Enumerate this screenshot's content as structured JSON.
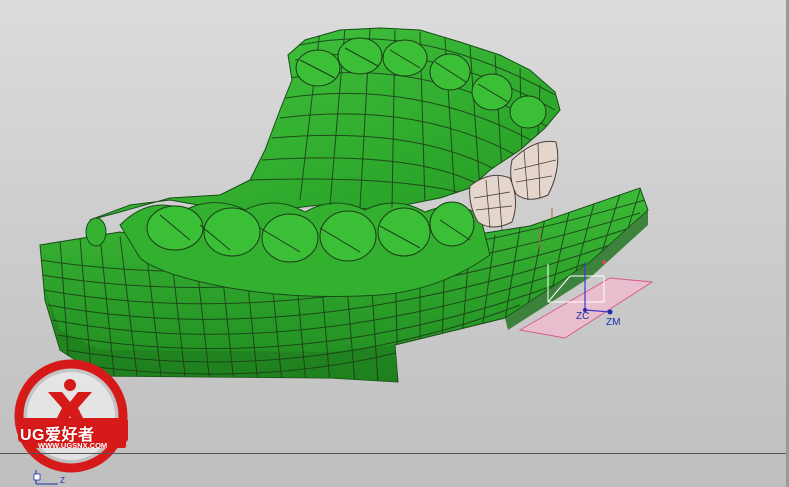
{
  "viewport": {
    "background_top": "#dcdcdc",
    "background_bottom": "#bfbfbf",
    "model_color": "#2ea52c",
    "mesh_line_color": "#1c3a18",
    "crown_color": "#e5d6cd",
    "plane_color": "#f3b9cf"
  },
  "triad": {
    "zc_label": "ZC",
    "zm_label": "ZM",
    "axis_color": "#1a2fa8"
  },
  "corner_axis": {
    "label": "Z"
  },
  "logo": {
    "text": "UG爱好者",
    "url": "WWW.UGSNX.COM",
    "ring_color": "#d61a1a"
  }
}
